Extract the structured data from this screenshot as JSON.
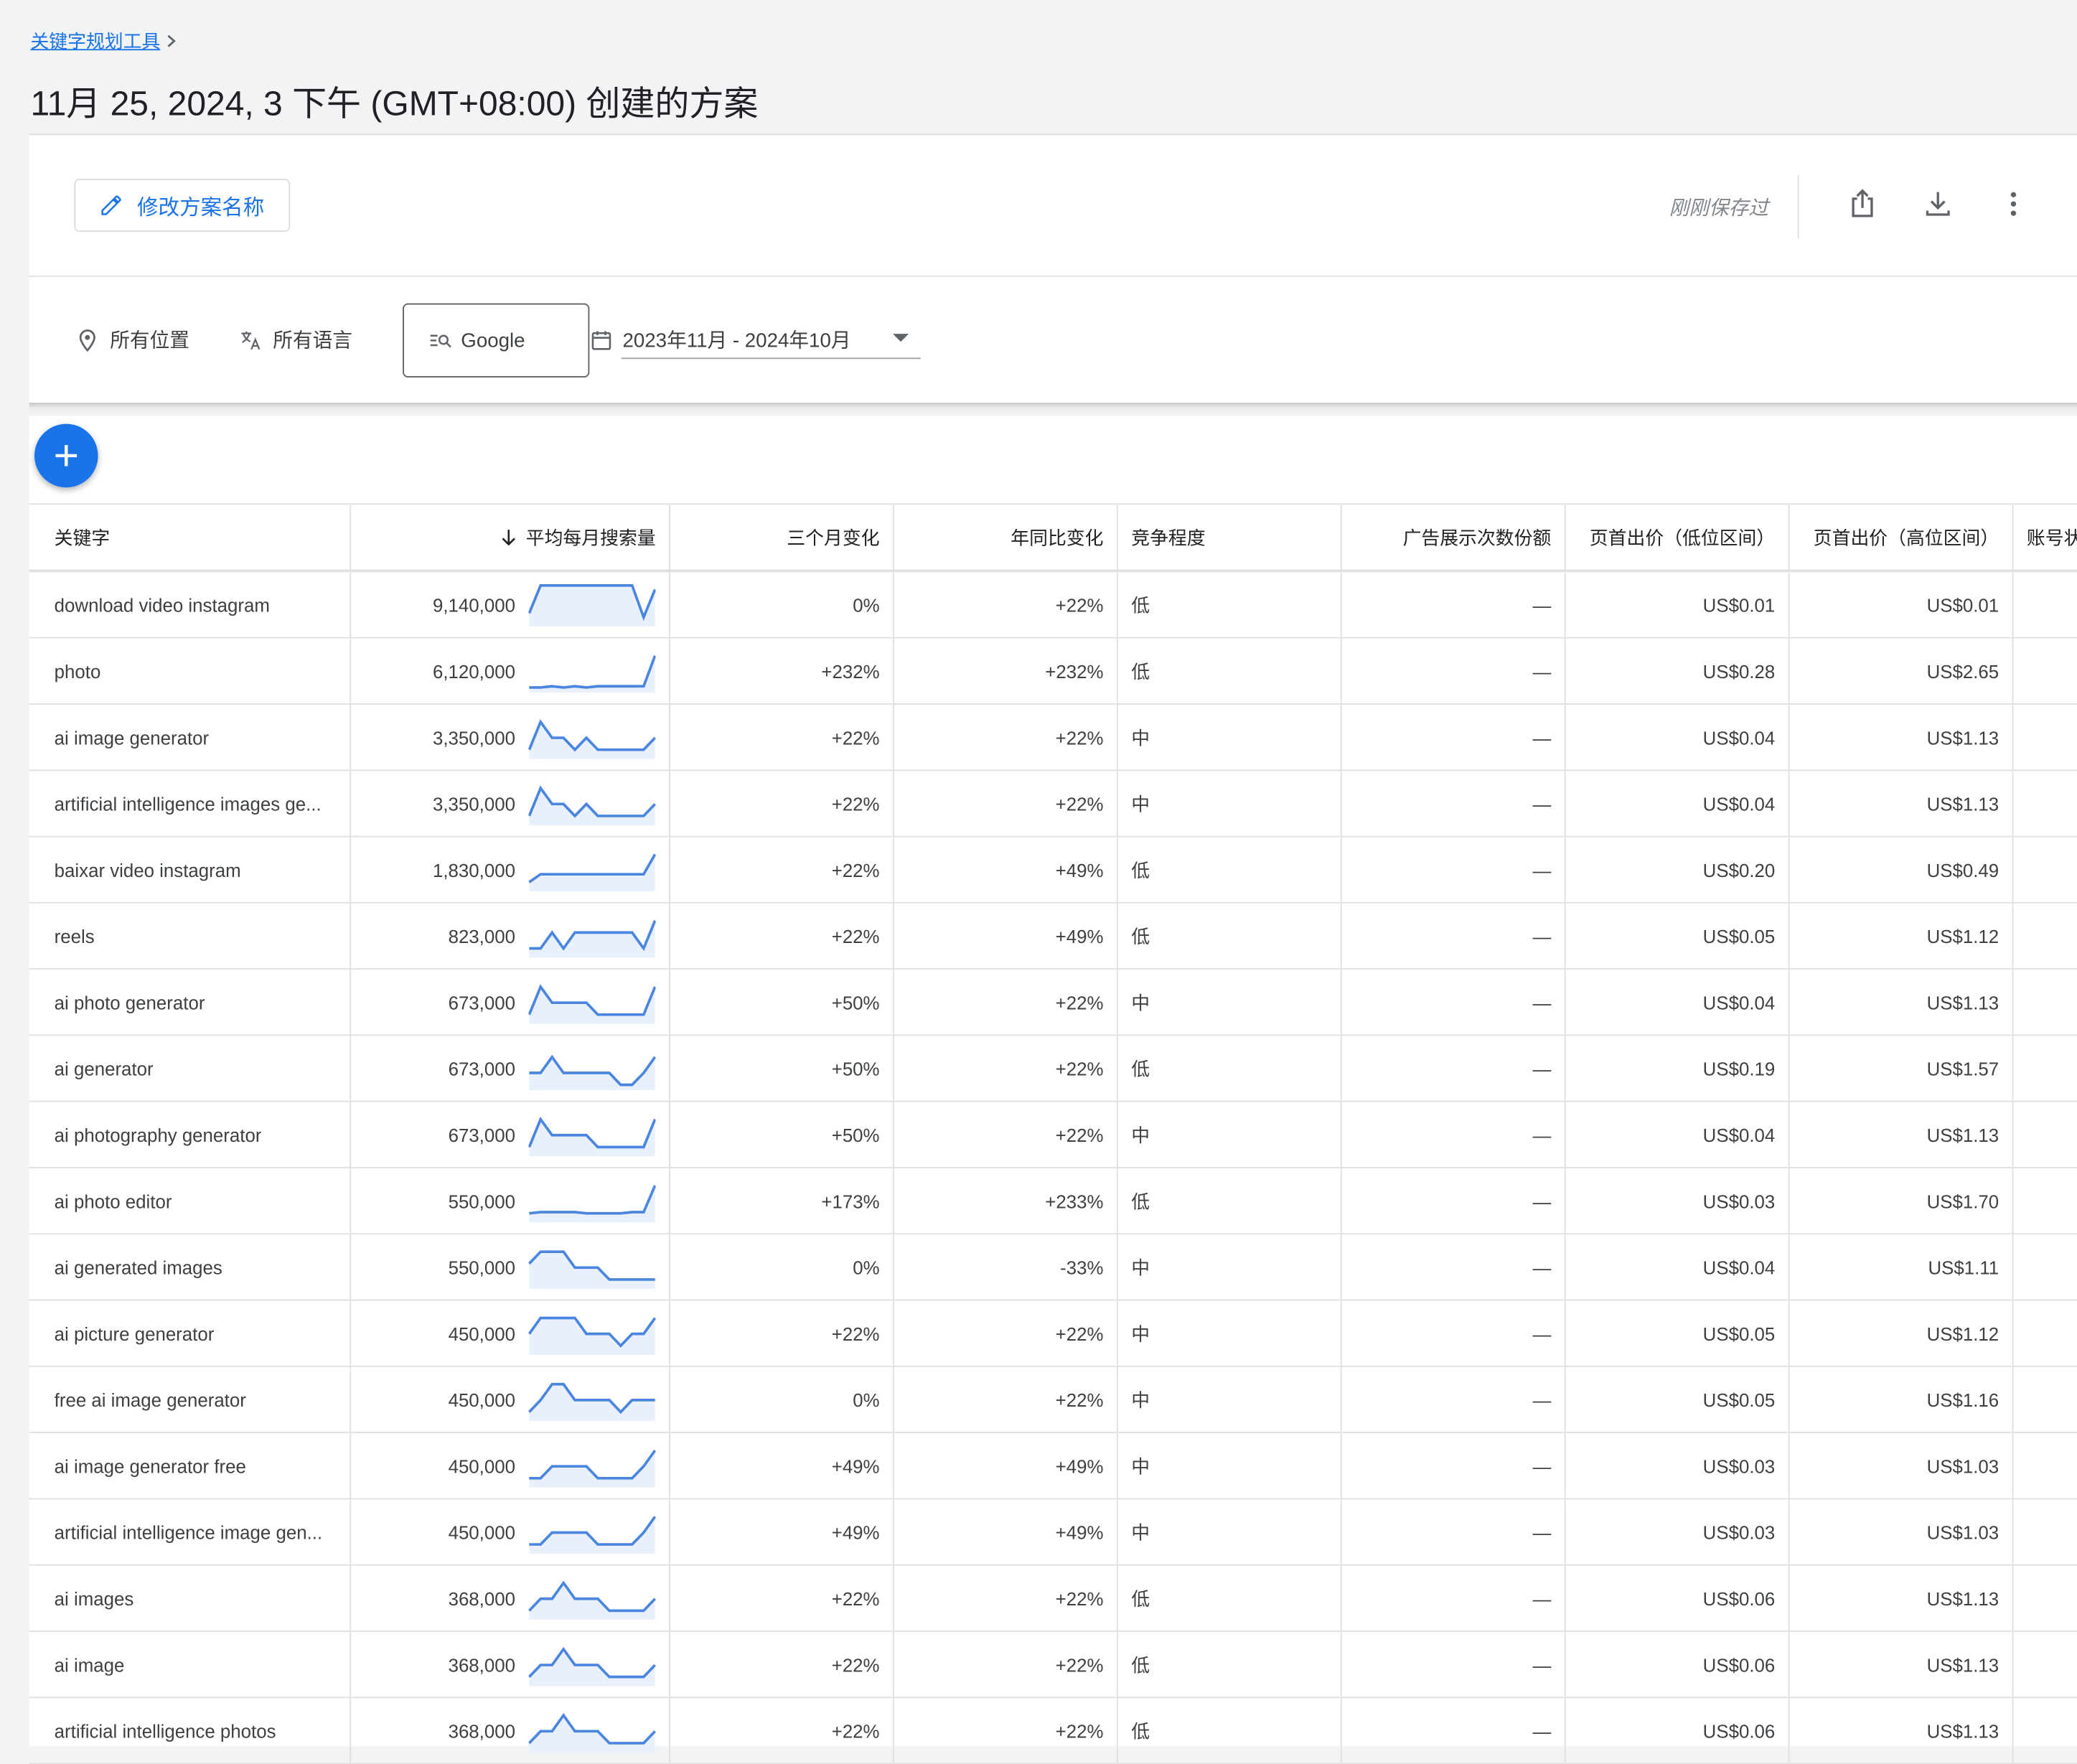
{
  "breadcrumb": {
    "label": "关键字规划工具"
  },
  "page": {
    "title": "11月 25, 2024, 3 下午 (GMT+08:00) 创建的方案"
  },
  "header_bar": {
    "rename_label": "修改方案名称",
    "saved_status": "刚刚保存过"
  },
  "filters": {
    "location": "所有位置",
    "language": "所有语言",
    "network": "Google",
    "date_range": "2023年11月 - 2024年10月"
  },
  "table": {
    "columns": {
      "keyword": "关键字",
      "avg_searches": "平均每月搜索量",
      "three_month": "三个月变化",
      "yoy": "年同比变化",
      "competition": "竞争程度",
      "impr_share": "广告展示次数份额",
      "bid_low": "页首出价（低位区间）",
      "bid_high": "页首出价（高位区间）",
      "account": "账号状"
    },
    "rows": [
      {
        "keyword": "download video instagram",
        "volume": "9,140,000",
        "three_month": "0%",
        "yoy": "+22%",
        "competition": "低",
        "impr_share": "—",
        "bid_low": "US$0.01",
        "bid_high": "US$0.01",
        "trend": [
          3,
          10,
          10,
          10,
          10,
          10,
          10,
          10,
          10,
          10,
          2,
          9
        ]
      },
      {
        "keyword": "photo",
        "volume": "6,120,000",
        "three_month": "+232%",
        "yoy": "+232%",
        "competition": "低",
        "impr_share": "—",
        "bid_low": "US$0.28",
        "bid_high": "US$2.65",
        "trend": [
          1,
          1,
          1.3,
          1,
          1.3,
          1,
          1.3,
          1.3,
          1.3,
          1.3,
          1.3,
          9
        ]
      },
      {
        "keyword": "ai image generator",
        "volume": "3,350,000",
        "three_month": "+22%",
        "yoy": "+22%",
        "competition": "中",
        "impr_share": "—",
        "bid_low": "US$0.04",
        "bid_high": "US$1.13",
        "trend": [
          2,
          9,
          5,
          5,
          2,
          5,
          2,
          2,
          2,
          2,
          2,
          5
        ]
      },
      {
        "keyword": "artificial intelligence images ge...",
        "volume": "3,350,000",
        "three_month": "+22%",
        "yoy": "+22%",
        "competition": "中",
        "impr_share": "—",
        "bid_low": "US$0.04",
        "bid_high": "US$1.13",
        "trend": [
          2,
          9,
          5,
          5,
          2,
          5,
          2,
          2,
          2,
          2,
          2,
          5
        ]
      },
      {
        "keyword": "baixar video instagram",
        "volume": "1,830,000",
        "three_month": "+22%",
        "yoy": "+49%",
        "competition": "低",
        "impr_share": "—",
        "bid_low": "US$0.20",
        "bid_high": "US$0.49",
        "trend": [
          2,
          4,
          4,
          4,
          4,
          4,
          4,
          4,
          4,
          4,
          4,
          9
        ]
      },
      {
        "keyword": "reels",
        "volume": "823,000",
        "three_month": "+22%",
        "yoy": "+49%",
        "competition": "低",
        "impr_share": "—",
        "bid_low": "US$0.05",
        "bid_high": "US$1.12",
        "trend": [
          2,
          2,
          6,
          2,
          6,
          6,
          6,
          6,
          6,
          6,
          2,
          9
        ]
      },
      {
        "keyword": "ai photo generator",
        "volume": "673,000",
        "three_month": "+50%",
        "yoy": "+22%",
        "competition": "中",
        "impr_share": "—",
        "bid_low": "US$0.04",
        "bid_high": "US$1.13",
        "trend": [
          2,
          9,
          5,
          5,
          5,
          5,
          2,
          2,
          2,
          2,
          2,
          9
        ]
      },
      {
        "keyword": "ai generator",
        "volume": "673,000",
        "three_month": "+50%",
        "yoy": "+22%",
        "competition": "低",
        "impr_share": "—",
        "bid_low": "US$0.19",
        "bid_high": "US$1.57",
        "trend": [
          4,
          4,
          8,
          4,
          4,
          4,
          4,
          4,
          1,
          1,
          4,
          8
        ]
      },
      {
        "keyword": "ai photography generator",
        "volume": "673,000",
        "three_month": "+50%",
        "yoy": "+22%",
        "competition": "中",
        "impr_share": "—",
        "bid_low": "US$0.04",
        "bid_high": "US$1.13",
        "trend": [
          2,
          9,
          5,
          5,
          5,
          5,
          2,
          2,
          2,
          2,
          2,
          9
        ]
      },
      {
        "keyword": "ai photo editor",
        "volume": "550,000",
        "three_month": "+173%",
        "yoy": "+233%",
        "competition": "低",
        "impr_share": "—",
        "bid_low": "US$0.03",
        "bid_high": "US$1.70",
        "trend": [
          2,
          2.3,
          2.3,
          2.3,
          2.3,
          2,
          2,
          2,
          2,
          2.3,
          2.3,
          9
        ]
      },
      {
        "keyword": "ai generated images",
        "volume": "550,000",
        "three_month": "0%",
        "yoy": "-33%",
        "competition": "中",
        "impr_share": "—",
        "bid_low": "US$0.04",
        "bid_high": "US$1.11",
        "trend": [
          6,
          9,
          9,
          9,
          5,
          5,
          5,
          2,
          2,
          2,
          2,
          2
        ]
      },
      {
        "keyword": "ai picture generator",
        "volume": "450,000",
        "three_month": "+22%",
        "yoy": "+22%",
        "competition": "中",
        "impr_share": "—",
        "bid_low": "US$0.05",
        "bid_high": "US$1.12",
        "trend": [
          5,
          9,
          9,
          9,
          9,
          5,
          5,
          5,
          2,
          5,
          5,
          9
        ]
      },
      {
        "keyword": "free ai image generator",
        "volume": "450,000",
        "three_month": "0%",
        "yoy": "+22%",
        "competition": "中",
        "impr_share": "—",
        "bid_low": "US$0.05",
        "bid_high": "US$1.16",
        "trend": [
          2,
          5,
          9,
          9,
          5,
          5,
          5,
          5,
          2,
          5,
          5,
          5
        ]
      },
      {
        "keyword": "ai image generator free",
        "volume": "450,000",
        "three_month": "+49%",
        "yoy": "+49%",
        "competition": "中",
        "impr_share": "—",
        "bid_low": "US$0.03",
        "bid_high": "US$1.03",
        "trend": [
          2,
          2,
          5,
          5,
          5,
          5,
          2,
          2,
          2,
          2,
          5,
          9
        ]
      },
      {
        "keyword": "artificial intelligence image gen...",
        "volume": "450,000",
        "three_month": "+49%",
        "yoy": "+49%",
        "competition": "中",
        "impr_share": "—",
        "bid_low": "US$0.03",
        "bid_high": "US$1.03",
        "trend": [
          2,
          2,
          5,
          5,
          5,
          5,
          2,
          2,
          2,
          2,
          5,
          9
        ]
      },
      {
        "keyword": "ai images",
        "volume": "368,000",
        "three_month": "+22%",
        "yoy": "+22%",
        "competition": "低",
        "impr_share": "—",
        "bid_low": "US$0.06",
        "bid_high": "US$1.13",
        "trend": [
          2,
          5,
          5,
          9,
          5,
          5,
          5,
          2,
          2,
          2,
          2,
          5
        ]
      },
      {
        "keyword": "ai image",
        "volume": "368,000",
        "three_month": "+22%",
        "yoy": "+22%",
        "competition": "低",
        "impr_share": "—",
        "bid_low": "US$0.06",
        "bid_high": "US$1.13",
        "trend": [
          2,
          5,
          5,
          9,
          5,
          5,
          5,
          2,
          2,
          2,
          2,
          5
        ]
      },
      {
        "keyword": "artificial intelligence photos",
        "volume": "368,000",
        "three_month": "+22%",
        "yoy": "+22%",
        "competition": "低",
        "impr_share": "—",
        "bid_low": "US$0.06",
        "bid_high": "US$1.13",
        "trend": [
          2,
          5,
          5,
          9,
          5,
          5,
          5,
          2,
          2,
          2,
          2,
          5
        ]
      }
    ]
  },
  "colors": {
    "accent": "#1a73e8",
    "spark_line": "#4a86e0",
    "spark_fill": "#e8f0fe"
  },
  "icons": [
    "pencil-icon",
    "share-icon",
    "download-icon",
    "more-vert-icon",
    "location-pin-icon",
    "translate-icon",
    "search-network-icon",
    "calendar-icon",
    "add-icon",
    "arrow-down-sort-icon",
    "chevron-right-icon"
  ]
}
